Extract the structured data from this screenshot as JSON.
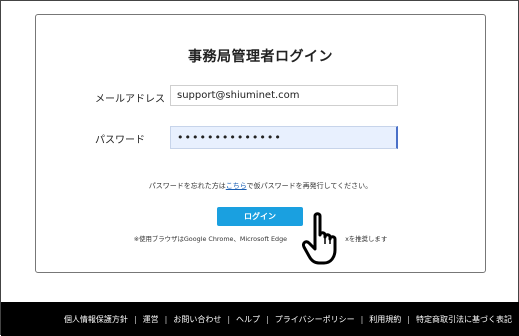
{
  "login": {
    "title": "事務局管理者ログイン",
    "email_label": "メールアドレス",
    "email_value": "support@shiuminet.com",
    "password_label": "パスワード",
    "password_value": "••••••••••••••",
    "forgot_prefix": "パスワードを忘れた方は",
    "forgot_link": "こちら",
    "forgot_suffix": "で仮パスワードを再発行してください。",
    "login_button": "ログイン",
    "browser_note_left": "※使用ブラウザはGoogle Chrome、Microsoft Edge",
    "browser_note_right": "xを推奨します"
  },
  "footer": {
    "links": [
      "個人情報保護方針",
      "運営",
      "お問い合わせ",
      "ヘルプ",
      "プライバシーポリシー",
      "利用規約",
      "特定商取引法に基づく表記"
    ],
    "separator": "|"
  },
  "colors": {
    "button": "#1aa0e0",
    "footer_bg": "#000000",
    "password_bg": "#e8f0fe",
    "link": "#1a5fb4"
  },
  "icons": {
    "cursor": "pointing-hand-cursor-icon"
  }
}
